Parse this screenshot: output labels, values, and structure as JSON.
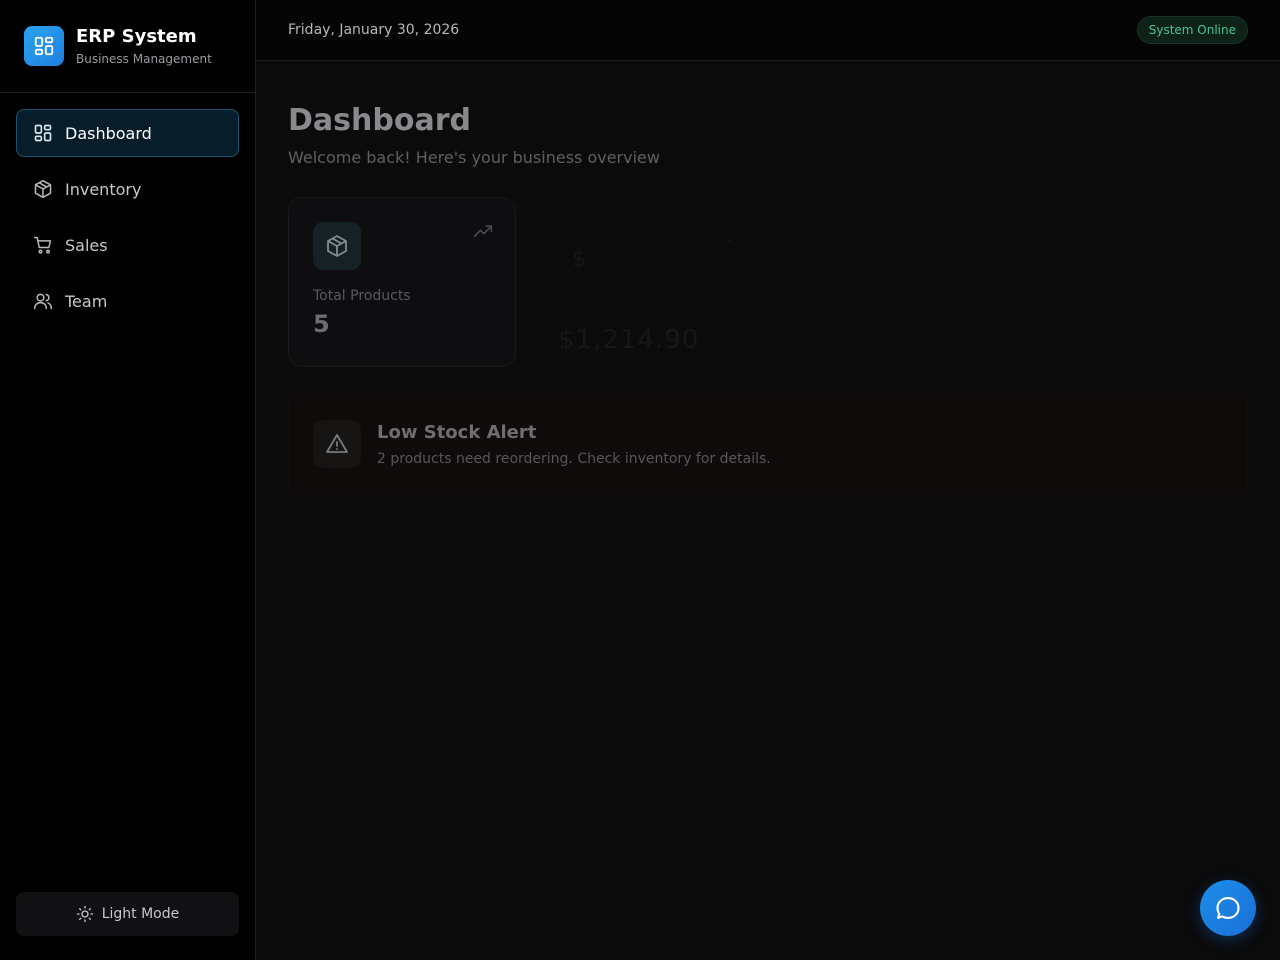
{
  "app": {
    "title": "ERP System",
    "subtitle": "Business Management",
    "accent": "#2196f3"
  },
  "sidebar": {
    "items": [
      {
        "label": "Dashboard",
        "icon": "dashboard-icon",
        "active": true
      },
      {
        "label": "Inventory",
        "icon": "package-icon",
        "active": false
      },
      {
        "label": "Sales",
        "icon": "cart-icon",
        "active": false
      },
      {
        "label": "Team",
        "icon": "users-icon",
        "active": false
      }
    ],
    "theme_toggle": {
      "label": "Light Mode",
      "icon": "sun-icon"
    }
  },
  "header": {
    "date": "Friday, January 30, 2026",
    "status": "System Online",
    "status_color": "#4cc38a"
  },
  "main": {
    "title": "Dashboard",
    "subtitle": "Welcome back! Here's your business overview",
    "stats": [
      {
        "label": "Total Products",
        "value": "5",
        "icon": "package-icon",
        "trend_icon": "trending-up-icon"
      },
      {
        "currency_symbol": "$",
        "value": "$1,214.90",
        "icon": "dollar-icon"
      }
    ],
    "alert": {
      "title": "Low Stock Alert",
      "text": "2 products need reordering. Check inventory for details.",
      "icon": "warning-icon"
    }
  },
  "fab": {
    "icon": "chat-icon"
  }
}
